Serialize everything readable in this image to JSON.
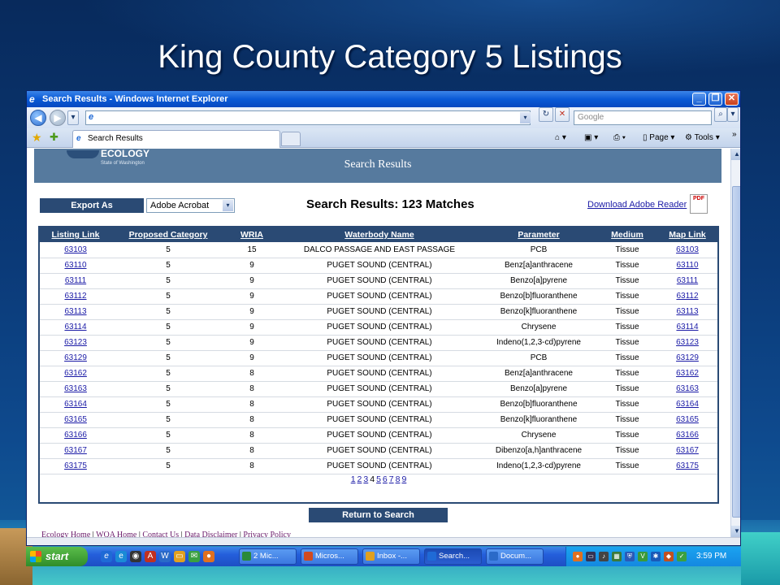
{
  "slide": {
    "title": "King County Category 5 Listings"
  },
  "window": {
    "title": "Search Results - Windows Internet Explorer",
    "buttons": {
      "minimize": "_",
      "maximize": "❐",
      "close": "✕"
    }
  },
  "browser": {
    "search_placeholder": "Google",
    "tab_label": "Search Results",
    "commands": {
      "page": "Page",
      "tools": "Tools"
    }
  },
  "page": {
    "logo_name": "ECOLOGY",
    "logo_state": "State of Washington",
    "header_title": "Search Results",
    "export_label": "Export As",
    "export_value": "Adobe Acrobat",
    "matches_text": "Search Results: 123  Matches",
    "adobe_link": "Download Adobe Reader",
    "pdf_icon_label": "PDF",
    "table": {
      "columns": [
        "Listing Link",
        "Proposed Category",
        "WRIA",
        "Waterbody Name",
        "Parameter",
        "Medium",
        "Map Link"
      ],
      "rows": [
        [
          "63103",
          "5",
          "15",
          "DALCO PASSAGE AND EAST PASSAGE",
          "PCB",
          "Tissue",
          "63103"
        ],
        [
          "63110",
          "5",
          "9",
          "PUGET SOUND (CENTRAL)",
          "Benz[a]anthracene",
          "Tissue",
          "63110"
        ],
        [
          "63111",
          "5",
          "9",
          "PUGET SOUND (CENTRAL)",
          "Benzo[a]pyrene",
          "Tissue",
          "63111"
        ],
        [
          "63112",
          "5",
          "9",
          "PUGET SOUND (CENTRAL)",
          "Benzo[b]fluoranthene",
          "Tissue",
          "63112"
        ],
        [
          "63113",
          "5",
          "9",
          "PUGET SOUND (CENTRAL)",
          "Benzo[k]fluoranthene",
          "Tissue",
          "63113"
        ],
        [
          "63114",
          "5",
          "9",
          "PUGET SOUND (CENTRAL)",
          "Chrysene",
          "Tissue",
          "63114"
        ],
        [
          "63123",
          "5",
          "9",
          "PUGET SOUND (CENTRAL)",
          "Indeno(1,2,3-cd)pyrene",
          "Tissue",
          "63123"
        ],
        [
          "63129",
          "5",
          "9",
          "PUGET SOUND (CENTRAL)",
          "PCB",
          "Tissue",
          "63129"
        ],
        [
          "63162",
          "5",
          "8",
          "PUGET SOUND (CENTRAL)",
          "Benz[a]anthracene",
          "Tissue",
          "63162"
        ],
        [
          "63163",
          "5",
          "8",
          "PUGET SOUND (CENTRAL)",
          "Benzo[a]pyrene",
          "Tissue",
          "63163"
        ],
        [
          "63164",
          "5",
          "8",
          "PUGET SOUND (CENTRAL)",
          "Benzo[b]fluoranthene",
          "Tissue",
          "63164"
        ],
        [
          "63165",
          "5",
          "8",
          "PUGET SOUND (CENTRAL)",
          "Benzo[k]fluoranthene",
          "Tissue",
          "63165"
        ],
        [
          "63166",
          "5",
          "8",
          "PUGET SOUND (CENTRAL)",
          "Chrysene",
          "Tissue",
          "63166"
        ],
        [
          "63167",
          "5",
          "8",
          "PUGET SOUND (CENTRAL)",
          "Dibenzo[a,h]anthracene",
          "Tissue",
          "63167"
        ],
        [
          "63175",
          "5",
          "8",
          "PUGET SOUND (CENTRAL)",
          "Indeno(1,2,3-cd)pyrene",
          "Tissue",
          "63175"
        ]
      ]
    },
    "pager": {
      "pages": [
        "1",
        "2",
        "3",
        "4",
        "5",
        "6",
        "7",
        "8",
        "9"
      ],
      "current": "4"
    },
    "return_button": "Return to Search",
    "footer_links": [
      "Ecology Home",
      "WQA Home",
      "Contact Us",
      "Data Disclaimer",
      "Privacy Policy"
    ]
  },
  "taskbar": {
    "start_label": "start",
    "tasks": [
      "2 Mic...",
      "Micros...",
      "Inbox -...",
      "Search...",
      "Docum..."
    ],
    "active_task": "Search...",
    "clock": "3:59 PM"
  }
}
